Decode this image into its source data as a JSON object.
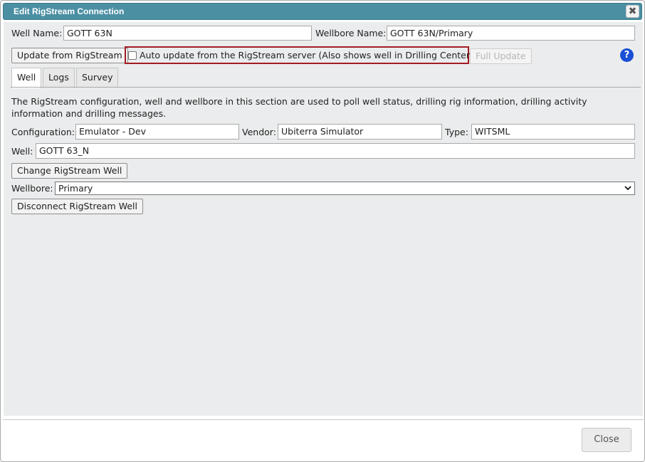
{
  "dialog": {
    "title": "Edit RigStream Connection",
    "close_glyph": "✖"
  },
  "header": {
    "well_name_label": "Well Name:",
    "well_name_value": "GOTT 63N",
    "wellbore_name_label": "Wellbore Name:",
    "wellbore_name_value": "GOTT 63N/Primary",
    "update_button": "Update from RigStream",
    "auto_update_label": "Auto update from the RigStream server (Also shows well in Drilling Center)",
    "auto_update_checked": false,
    "full_update_button": "Full Update",
    "help_glyph": "?"
  },
  "tabs": [
    {
      "label": "Well",
      "active": true
    },
    {
      "label": "Logs",
      "active": false
    },
    {
      "label": "Survey",
      "active": false
    }
  ],
  "well_tab": {
    "description": "The RigStream configuration, well and wellbore in this section are used to poll well status, drilling rig information, drilling activity information and drilling messages.",
    "configuration_label": "Configuration:",
    "configuration_value": "Emulator - Dev",
    "vendor_label": "Vendor:",
    "vendor_value": "Ubiterra Simulator",
    "type_label": "Type:",
    "type_value": "WITSML",
    "well_label": "Well:",
    "well_value": "GOTT 63_N",
    "change_well_button": "Change RigStream Well",
    "wellbore_label": "Wellbore:",
    "wellbore_selected": "Primary",
    "disconnect_button": "Disconnect RigStream Well"
  },
  "footer": {
    "close_button": "Close"
  },
  "colors": {
    "titlebar": "#4b8fa3",
    "highlight": "#a21d24",
    "help": "#1a4fd6",
    "content_bg": "#ebeced"
  }
}
